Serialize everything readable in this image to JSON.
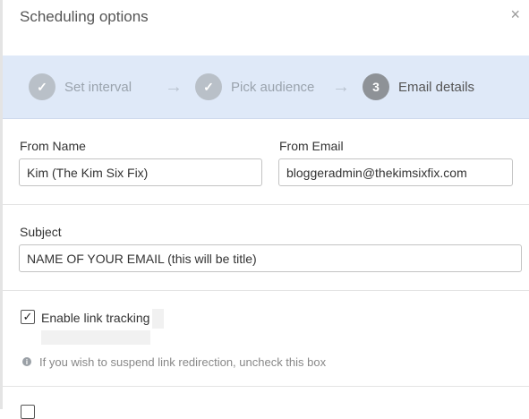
{
  "modal": {
    "title": "Scheduling options",
    "close_icon": "×"
  },
  "steps": [
    {
      "label": "Set interval",
      "marker": "✓",
      "state": "done"
    },
    {
      "label": "Pick audience",
      "marker": "✓",
      "state": "done"
    },
    {
      "label": "Email details",
      "marker": "3",
      "state": "active"
    }
  ],
  "step_arrow": "→",
  "form": {
    "from_name": {
      "label": "From Name",
      "value": "Kim (The Kim Six Fix)"
    },
    "from_email": {
      "label": "From Email",
      "value": "bloggeradmin@thekimsixfix.com"
    },
    "subject": {
      "label": "Subject",
      "value": "NAME OF YOUR EMAIL (this will be title)"
    },
    "link_tracking": {
      "label": "Enable link tracking",
      "checked": true,
      "check_mark": "✓",
      "hint": "If you wish to suspend link redirection, uncheck this box",
      "hint_icon": "i"
    }
  }
}
